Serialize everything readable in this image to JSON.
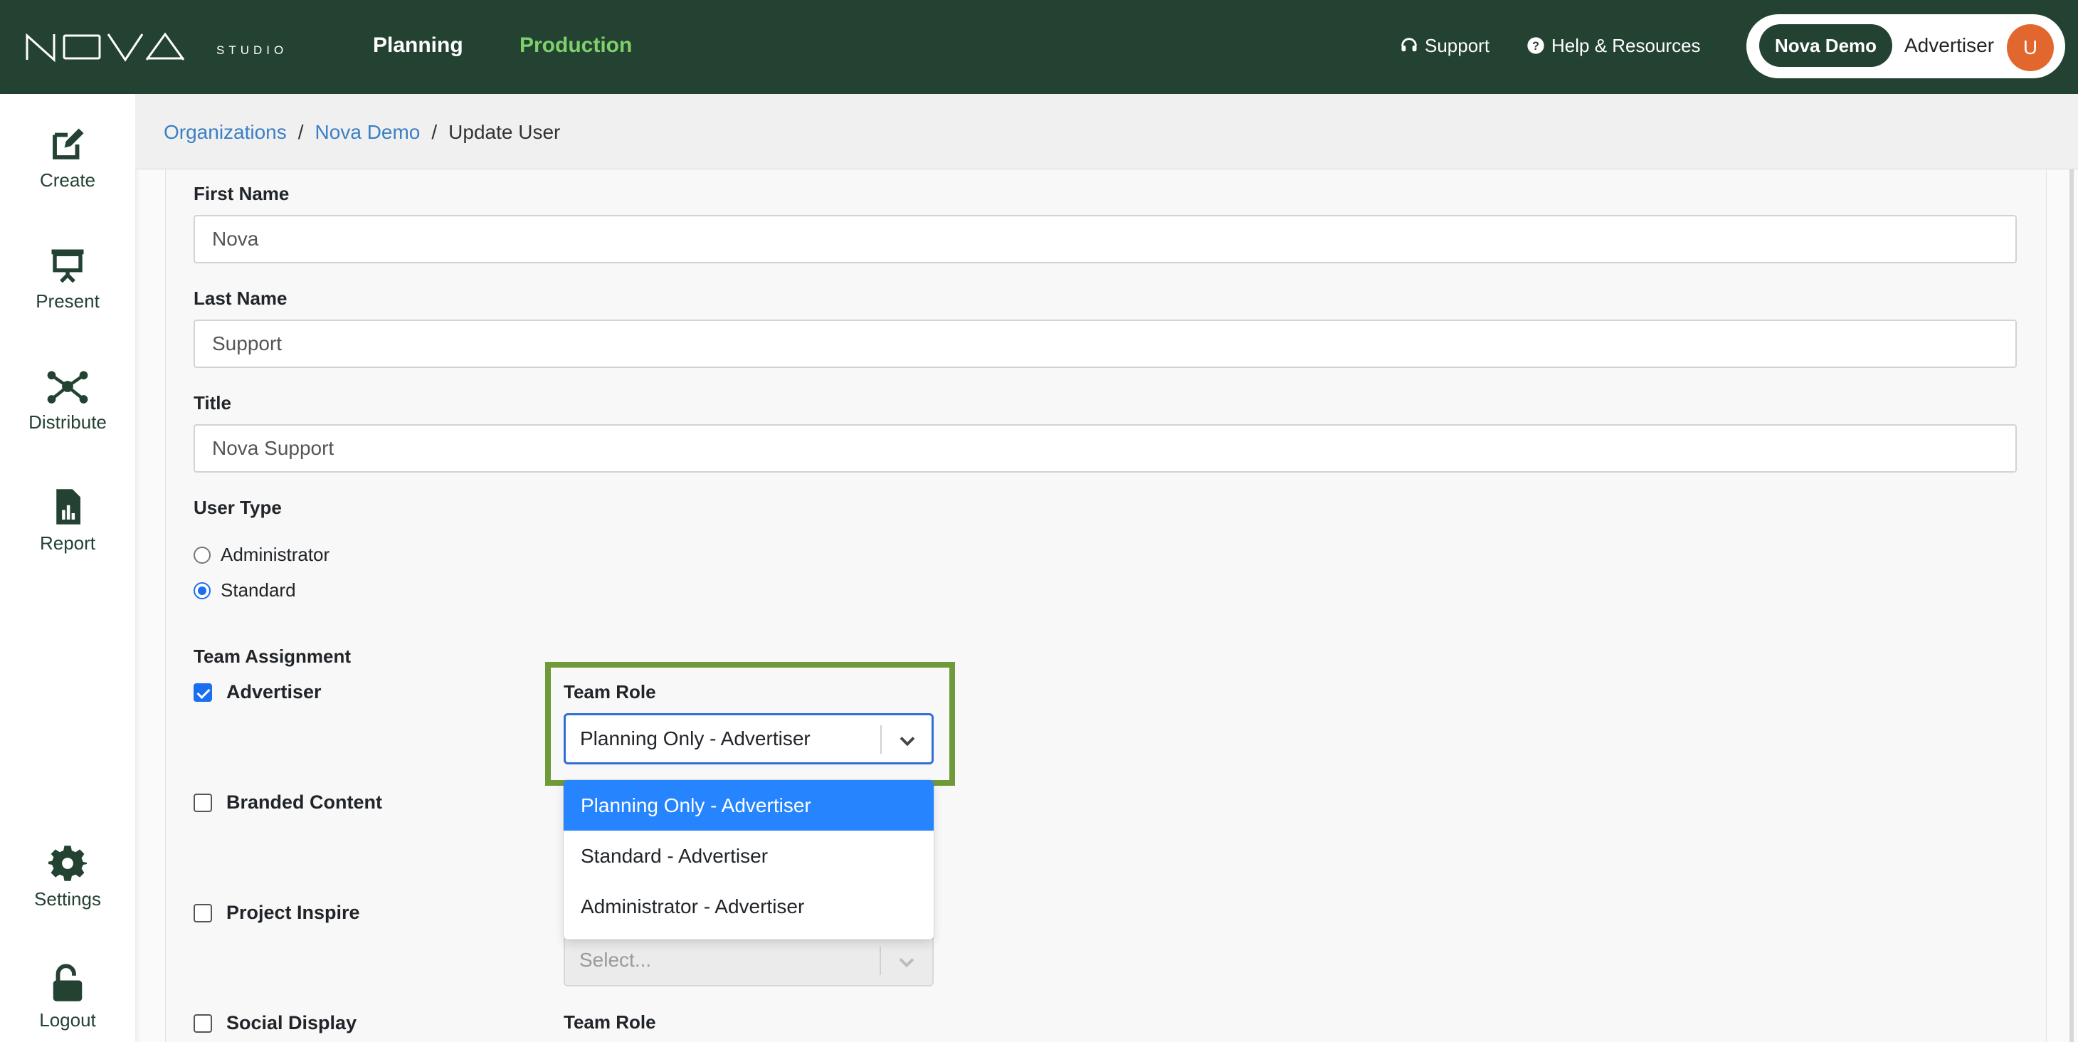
{
  "header": {
    "nav": [
      {
        "label": "Planning",
        "active": false
      },
      {
        "label": "Production",
        "active": true
      }
    ],
    "support_label": "Support",
    "help_label": "Help & Resources",
    "org_label": "Nova Demo",
    "team_label": "Advertiser",
    "avatar_initial": "U"
  },
  "sidebar": {
    "items": [
      {
        "label": "Create",
        "icon": "edit-icon"
      },
      {
        "label": "Present",
        "icon": "presentation-icon"
      },
      {
        "label": "Distribute",
        "icon": "network-icon"
      },
      {
        "label": "Report",
        "icon": "report-icon"
      },
      {
        "label": "Settings",
        "icon": "gear-icon"
      },
      {
        "label": "Logout",
        "icon": "unlock-icon"
      }
    ]
  },
  "breadcrumb": {
    "items": [
      "Organizations",
      "Nova Demo",
      "Update User"
    ],
    "separator": "/"
  },
  "form": {
    "first_name": {
      "label": "First Name",
      "value": "Nova"
    },
    "last_name": {
      "label": "Last Name",
      "value": "Support"
    },
    "title": {
      "label": "Title",
      "value": "Nova Support"
    },
    "user_type": {
      "label": "User Type",
      "options": [
        {
          "label": "Administrator",
          "selected": false
        },
        {
          "label": "Standard",
          "selected": true
        }
      ]
    },
    "team_assignment": {
      "label": "Team Assignment",
      "teams": [
        {
          "name": "Advertiser",
          "checked": true
        },
        {
          "name": "Branded Content",
          "checked": false
        },
        {
          "name": "Project Inspire",
          "checked": false
        },
        {
          "name": "Social Display",
          "checked": false
        }
      ],
      "role_label": "Team Role",
      "selected_role": "Planning Only - Advertiser",
      "role_options": [
        "Planning Only - Advertiser",
        "Standard - Advertiser",
        "Administrator - Advertiser"
      ],
      "disabled_placeholder": "Select..."
    }
  },
  "colors": {
    "header_bg": "#234232",
    "active_nav": "#7fd06a",
    "highlight_border": "#6f9a3a",
    "option_selected": "#2684ff",
    "link": "#3b7fc4",
    "avatar": "#e2672f"
  }
}
